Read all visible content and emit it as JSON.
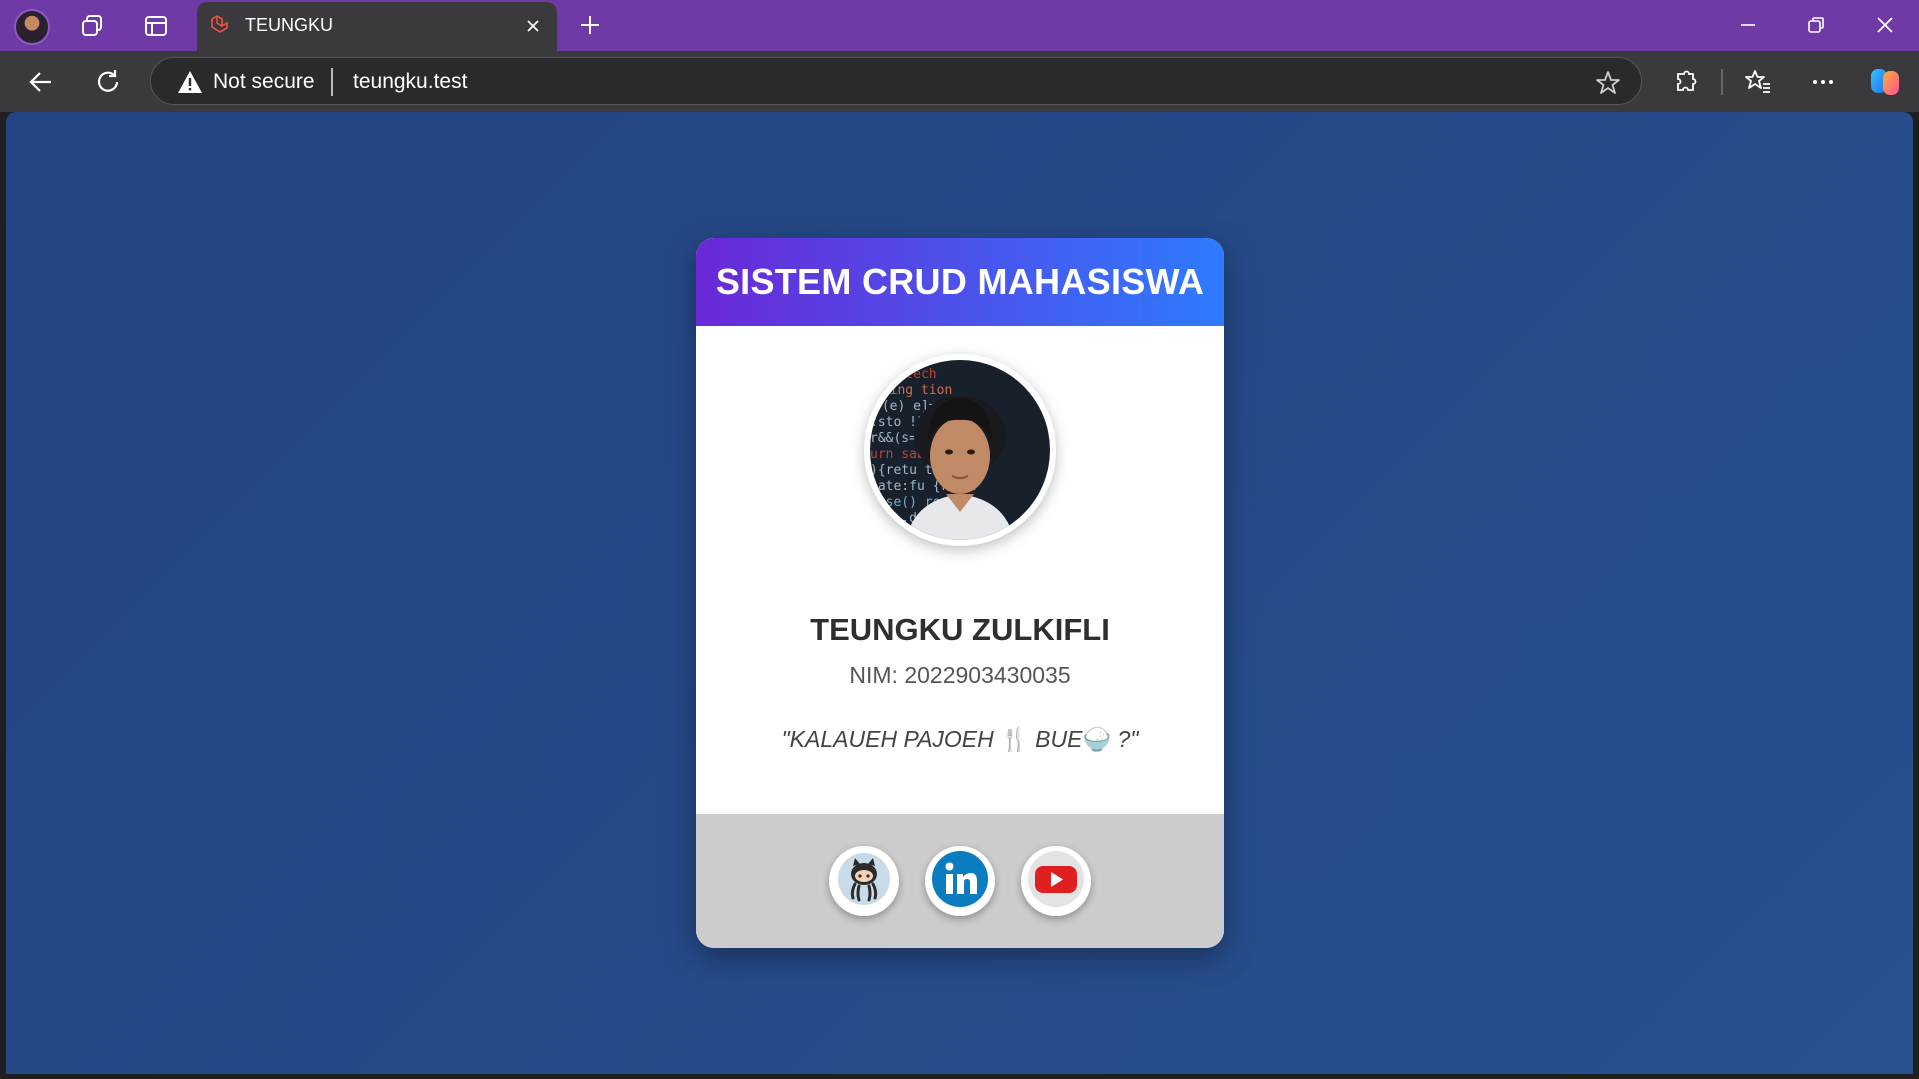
{
  "browser": {
    "tab_title": "TEUNGKU",
    "security_label": "Not secure",
    "url": "teungku.test",
    "accent_color": "#6f3aa6"
  },
  "icons": {
    "titlebar": [
      "profile-avatar",
      "workspaces-icon",
      "tab-actions-icon",
      "laravel-favicon",
      "close-icon",
      "new-tab-icon",
      "minimize-icon",
      "restore-icon",
      "close-window-icon"
    ],
    "toolbar": [
      "back-icon",
      "refresh-icon",
      "warning-icon",
      "favorite-star-icon",
      "extensions-icon",
      "favorites-icon",
      "more-icon",
      "copilot-icon"
    ]
  },
  "page": {
    "background_color": "#254987",
    "card": {
      "header_title": "SISTEM CRUD MAHASISWA",
      "header_gradient": [
        "#6a28d6",
        "#2e7bff"
      ],
      "name": "TEUNGKU ZULKIFLI",
      "nim": "NIM: 2022903430035",
      "quote_text_1": "\"KALAUEH PAJOEH ",
      "quote_emoji_1": "🍴",
      "quote_text_2": " BUE",
      "quote_emoji_2": "🍚",
      "quote_text_3": " ?\"",
      "social_links": [
        "github-icon",
        "linkedin-icon",
        "youtube-icon"
      ]
    }
  }
}
